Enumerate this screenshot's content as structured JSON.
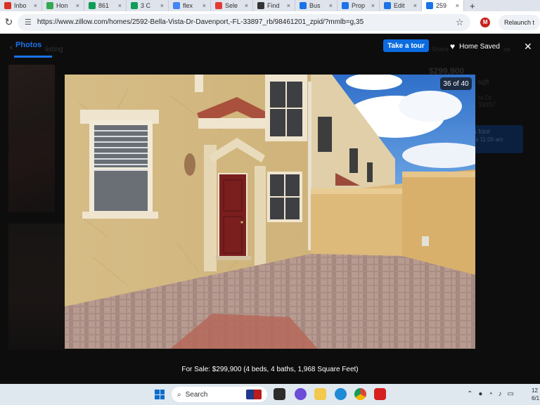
{
  "browser": {
    "tabs": [
      {
        "label": "Inbo",
        "color": "#d93025"
      },
      {
        "label": "Hon",
        "color": "#34a853"
      },
      {
        "label": "861",
        "color": "#0f9d58"
      },
      {
        "label": "3 C",
        "color": "#0f9d58"
      },
      {
        "label": "flex",
        "color": "#4285f4"
      },
      {
        "label": "Sele",
        "color": "#e53935"
      },
      {
        "label": "Find",
        "color": "#333333"
      },
      {
        "label": "Bus",
        "color": "#1a73e8"
      },
      {
        "label": "Prop",
        "color": "#1a73e8"
      },
      {
        "label": "Edit",
        "color": "#1a73e8"
      },
      {
        "label": "259",
        "color": "#1a73e8"
      }
    ],
    "url": "https://www.zillow.com/homes/2592-Bella-Vista-Dr-Davenport,-FL-33897_rb/98461201_zpid/?mmlb=g,35",
    "profile_initial": "M",
    "relaunch_label": "Relaunch t"
  },
  "viewer": {
    "photos_tab": "Photos",
    "take_tour": "Take a tour",
    "home_saved": "Home Saved",
    "counter": "36 of 40",
    "caption": "For Sale: $299,900 (4 beds, 4 baths, 1,968 Square Feet)"
  },
  "background": {
    "listing_ghost": "listing",
    "price_ghost": "$299,900",
    "sqft_ghost": "968 sqft",
    "addr_ghost": "ta Dr",
    "addr_ghost2": "33897",
    "share_ghost": "Share",
    "hide_ghost": "se",
    "tour_ghost": "a tour",
    "tour_ghost2": "as 11:00 am",
    "accent": "#0b6bdf"
  },
  "taskbar": {
    "search_placeholder": "Search",
    "time": "12",
    "date": "6/1"
  }
}
